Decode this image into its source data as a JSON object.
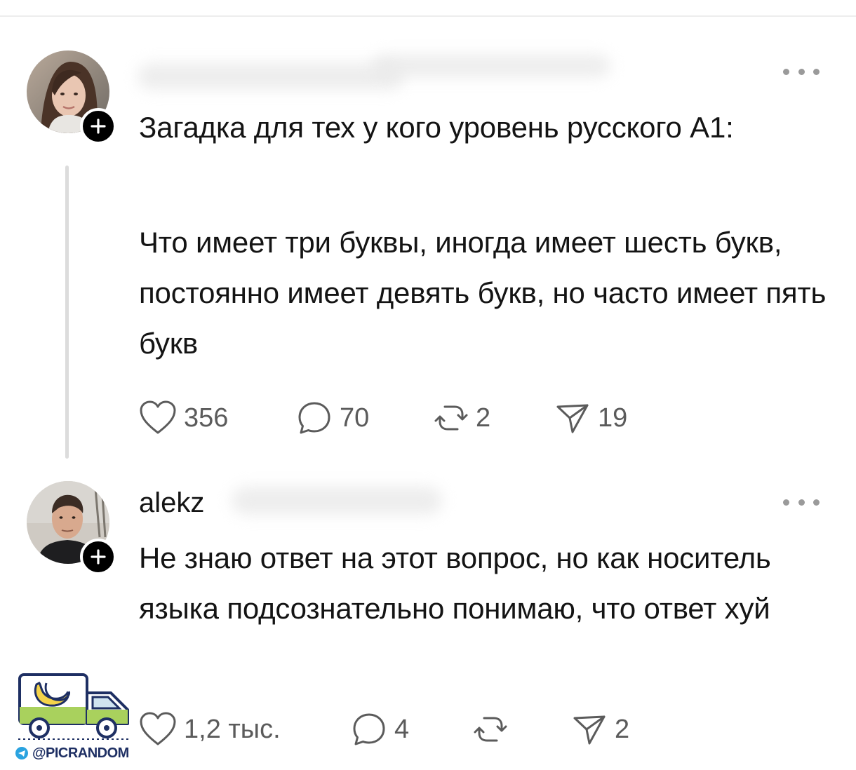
{
  "posts": [
    {
      "author": "",
      "paragraphs": [
        "Загадка для тех у кого уровень русского А1:",
        "Что имеет три буквы, иногда имеет шесть букв, постоянно имеет девять букв, но часто имеет пять букв"
      ],
      "stats": {
        "likes": "356",
        "replies": "70",
        "reposts": "2",
        "shares": "19"
      }
    },
    {
      "author": "alekz",
      "paragraphs": [
        "Не знаю ответ на этот вопрос, но как носитель языка подсознательно понимаю, что ответ хуй"
      ],
      "stats": {
        "likes": "1,2 тыс.",
        "replies": "4",
        "reposts": "",
        "shares": "2"
      }
    }
  ],
  "watermark": {
    "handle": "@PICRANDOM"
  },
  "icons": {
    "more": "more-dots-icon",
    "follow": "plus-icon",
    "like": "heart-icon",
    "reply": "speech-bubble-icon",
    "repost": "repost-arrows-icon",
    "share": "send-icon"
  },
  "colors": {
    "text": "#141414",
    "muted": "#5b5b5b",
    "badge": "#000000",
    "thread_line": "#dcdcdc"
  }
}
